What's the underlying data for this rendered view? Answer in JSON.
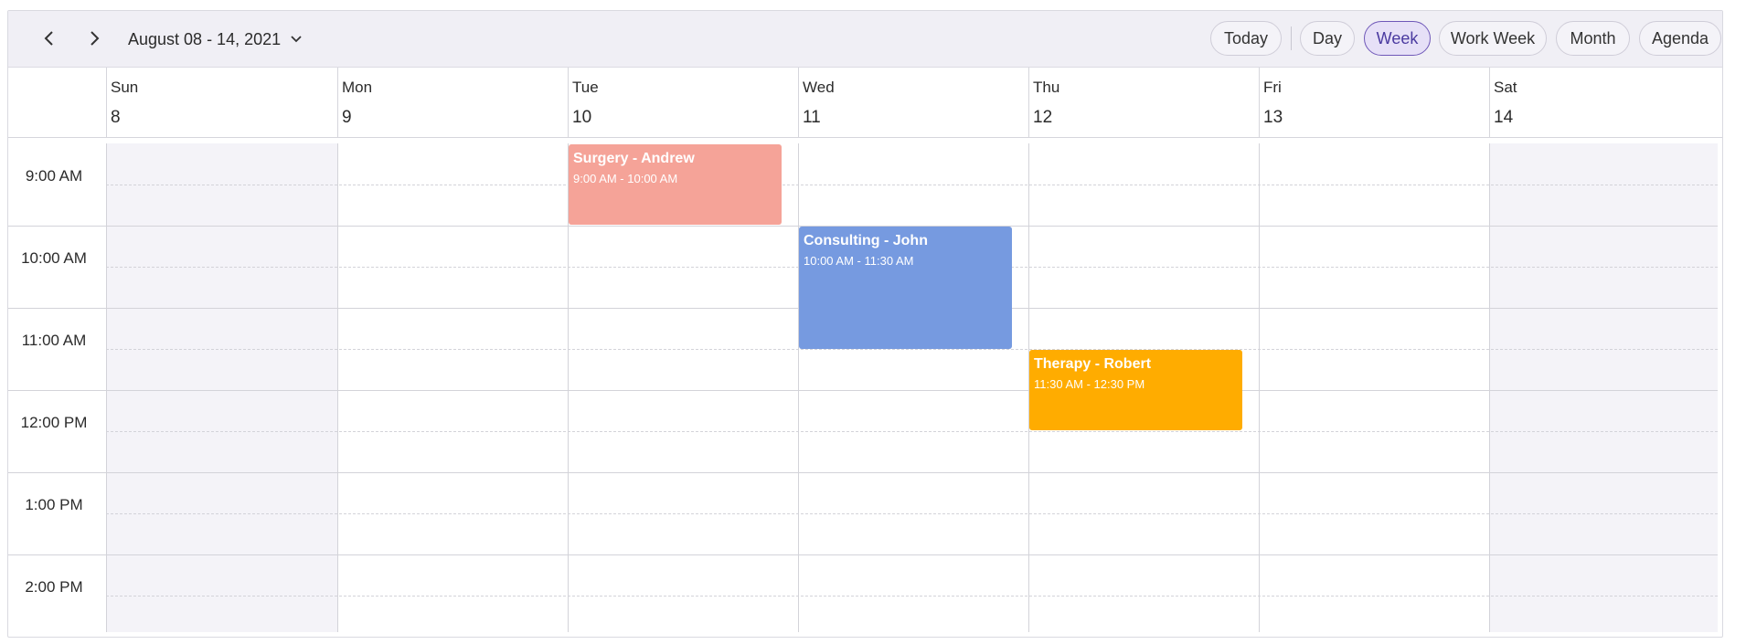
{
  "toolbar": {
    "prev_icon": "chevron-left-icon",
    "next_icon": "chevron-right-icon",
    "date_range": "August 08 - 14, 2021",
    "dropdown_icon": "chevron-down-icon",
    "today_label": "Today",
    "views": [
      "Day",
      "Week",
      "Work Week",
      "Month",
      "Agenda"
    ],
    "active_view": "Week"
  },
  "days": [
    {
      "name": "Sun",
      "num": "8"
    },
    {
      "name": "Mon",
      "num": "9"
    },
    {
      "name": "Tue",
      "num": "10"
    },
    {
      "name": "Wed",
      "num": "11"
    },
    {
      "name": "Thu",
      "num": "12"
    },
    {
      "name": "Fri",
      "num": "13"
    },
    {
      "name": "Sat",
      "num": "14"
    }
  ],
  "time_labels": [
    "9:00 AM",
    "10:00 AM",
    "11:00 AM",
    "12:00 PM",
    "1:00 PM",
    "2:00 PM"
  ],
  "events": [
    {
      "title": "Surgery - Andrew",
      "time": "9:00 AM - 10:00 AM",
      "day": "Tue",
      "color": "#f5a398"
    },
    {
      "title": "Consulting - John",
      "time": "10:00 AM - 11:30 AM",
      "day": "Wed",
      "color": "#769ae0"
    },
    {
      "title": "Therapy - Robert",
      "time": "11:30 AM - 12:30 PM",
      "day": "Thu",
      "color": "#ffac00"
    }
  ],
  "colors": {
    "toolbar_bg": "#f0eff5",
    "active_accent": "#6f58b8",
    "weekend_bg": "#f4f3f8"
  }
}
